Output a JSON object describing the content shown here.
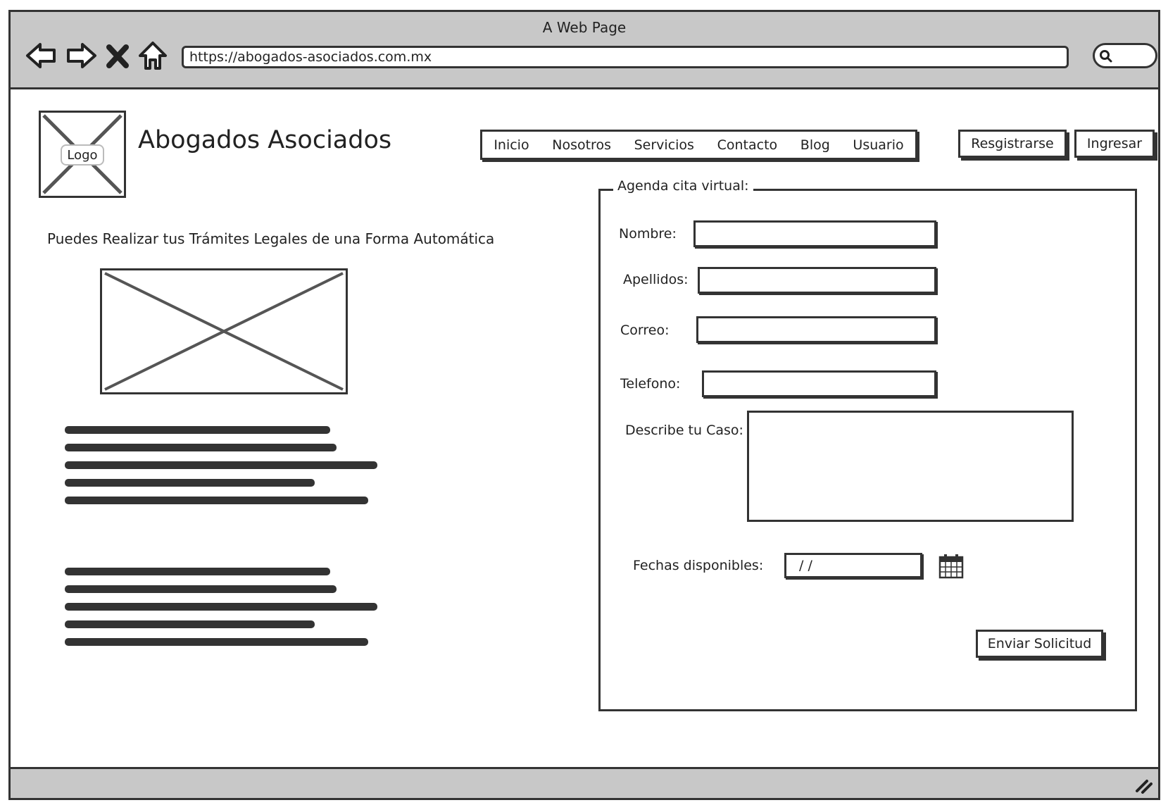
{
  "browser": {
    "window_title": "A Web Page",
    "url": "https://abogados-asociados.com.mx"
  },
  "site": {
    "logo_label": "Logo",
    "title": "Abogados Asociados",
    "nav": [
      "Inicio",
      "Nosotros",
      "Servicios",
      "Contacto",
      "Blog",
      "Usuario"
    ],
    "register_label": "Resgistrarse",
    "login_label": "Ingresar",
    "headline": "Puedes Realizar tus Trámites Legales de una Forma Automática"
  },
  "form": {
    "legend": "Agenda cita virtual:",
    "nombre_label": "Nombre:",
    "apellidos_label": "Apellidos:",
    "correo_label": "Correo:",
    "telefono_label": "Telefono:",
    "caso_label": "Describe tu Caso:",
    "fechas_label": "Fechas disponibles:",
    "date_value": "/ /",
    "submit_label": "Enviar Solicitud"
  }
}
